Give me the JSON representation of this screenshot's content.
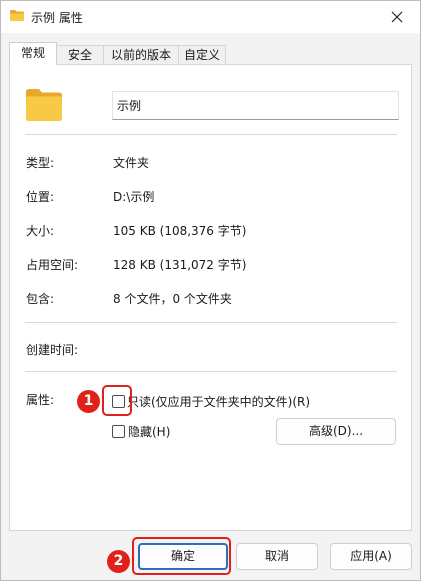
{
  "window": {
    "title": "示例 属性",
    "icons": {
      "title": "folder-icon",
      "close": "close-icon",
      "big": "folder-icon"
    }
  },
  "tabs": [
    {
      "label": "常规",
      "active": true
    },
    {
      "label": "安全",
      "active": false
    },
    {
      "label": "以前的版本",
      "active": false
    },
    {
      "label": "自定义",
      "active": false
    }
  ],
  "general": {
    "folder_name": "示例",
    "rows": [
      {
        "label": "类型:",
        "value": "文件夹"
      },
      {
        "label": "位置:",
        "value": "D:\\示例"
      },
      {
        "label": "大小:",
        "value": "105 KB (108,376 字节)"
      },
      {
        "label": "占用空间:",
        "value": "128 KB (131,072 字节)"
      },
      {
        "label": "包含:",
        "value": "8 个文件，0 个文件夹"
      }
    ],
    "created_label": "创建时间:",
    "created_value": "",
    "attributes_label": "属性:",
    "readonly": {
      "label": "只读(仅应用于文件夹中的文件)(R)",
      "checked": false
    },
    "hidden": {
      "label": "隐藏(H)",
      "checked": false
    },
    "advanced_label": "高级(D)..."
  },
  "buttons": {
    "ok": "确定",
    "cancel": "取消",
    "apply": "应用(A)"
  },
  "annotations": [
    {
      "number": "1",
      "target": "readonly-checkbox"
    },
    {
      "number": "2",
      "target": "ok-button"
    }
  ],
  "colors": {
    "annotation": "#e0201a",
    "folder_front": "#f8c945",
    "folder_back": "#e8a92b",
    "default_button_border": "#2f6dba"
  }
}
